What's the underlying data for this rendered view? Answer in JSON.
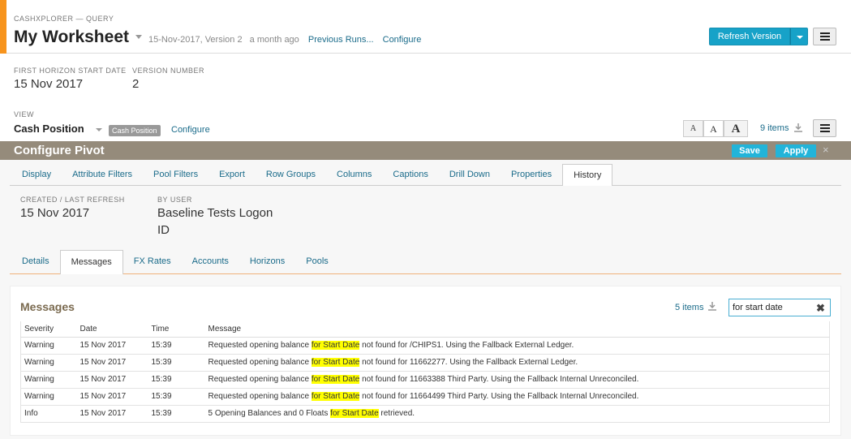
{
  "header": {
    "breadcrumb": "CASHXPLORER — QUERY",
    "title": "My Worksheet",
    "date_version": "15-Nov-2017, Version 2",
    "ago": "a month ago",
    "previous_runs": "Previous Runs...",
    "configure": "Configure",
    "refresh_button": "Refresh Version"
  },
  "info": {
    "first_horizon_label": "FIRST HORIZON START DATE",
    "first_horizon_value": "15 Nov 2017",
    "version_label": "VERSION NUMBER",
    "version_value": "2"
  },
  "view": {
    "label": "VIEW",
    "name": "Cash Position",
    "badge": "Cash Position",
    "configure": "Configure",
    "font_small": "A",
    "font_medium": "A",
    "font_large": "A",
    "items": "9 items"
  },
  "pivot": {
    "title": "Configure Pivot",
    "save": "Save",
    "apply": "Apply",
    "close": "×",
    "tabs": [
      "Display",
      "Attribute Filters",
      "Pool Filters",
      "Export",
      "Row Groups",
      "Columns",
      "Captions",
      "Drill Down",
      "Properties",
      "History"
    ],
    "active_tab": "History"
  },
  "history": {
    "created_label": "CREATED / LAST REFRESH",
    "created_value": "15 Nov 2017",
    "user_label": "BY USER",
    "user_line1": "Baseline Tests Logon",
    "user_line2": "ID",
    "subtabs": [
      "Details",
      "Messages",
      "FX Rates",
      "Accounts",
      "Horizons",
      "Pools"
    ],
    "active_subtab": "Messages"
  },
  "messages": {
    "title": "Messages",
    "items": "5 items",
    "search_value": "for start date",
    "columns": [
      "Severity",
      "Date",
      "Time",
      "Message"
    ],
    "highlight": "for Start Date",
    "rows": [
      {
        "severity": "Warning",
        "date": "15 Nov 2017",
        "time": "15:39",
        "pre": "Requested opening balance ",
        "post": " not found for /CHIPS1. Using the Fallback External Ledger."
      },
      {
        "severity": "Warning",
        "date": "15 Nov 2017",
        "time": "15:39",
        "pre": "Requested opening balance ",
        "post": " not found for 11662277. Using the Fallback External Ledger."
      },
      {
        "severity": "Warning",
        "date": "15 Nov 2017",
        "time": "15:39",
        "pre": "Requested opening balance ",
        "post": " not found for 11663388 Third Party. Using the Fallback Internal Unreconciled."
      },
      {
        "severity": "Warning",
        "date": "15 Nov 2017",
        "time": "15:39",
        "pre": "Requested opening balance ",
        "post": " not found for 11664499 Third Party. Using the Fallback Internal Unreconciled."
      },
      {
        "severity": "Info",
        "date": "15 Nov 2017",
        "time": "15:39",
        "pre": "5 Opening Balances and 0 Floats ",
        "post": " retrieved."
      }
    ]
  }
}
